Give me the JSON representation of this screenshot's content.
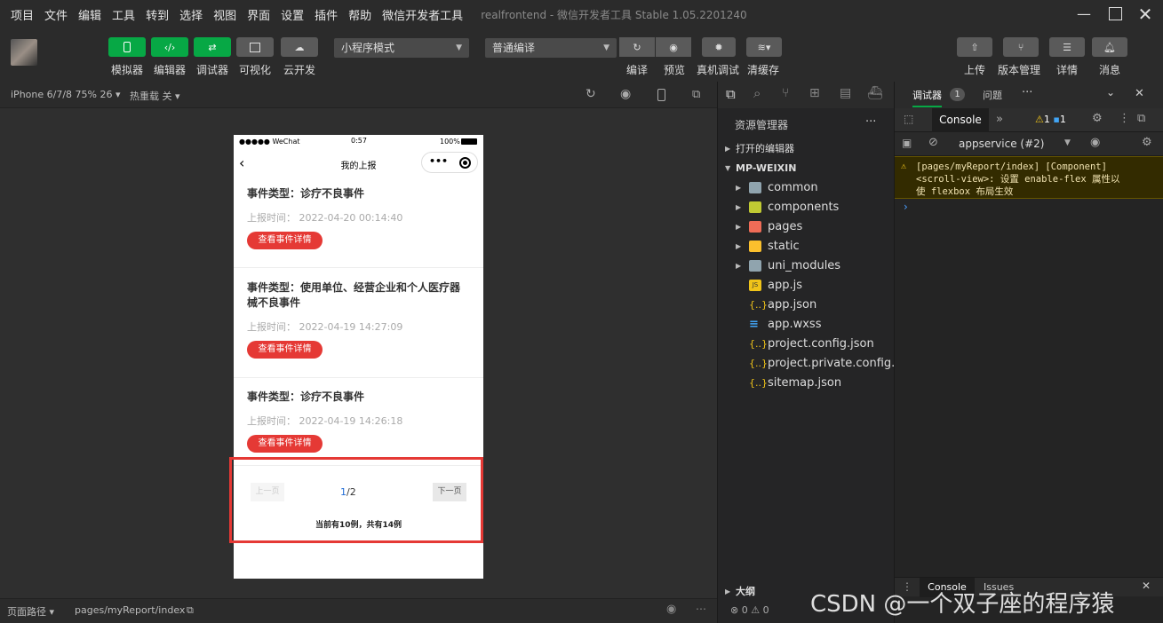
{
  "menubar": {
    "items": [
      "项目",
      "文件",
      "编辑",
      "工具",
      "转到",
      "选择",
      "视图",
      "界面",
      "设置",
      "插件",
      "帮助",
      "微信开发者工具"
    ],
    "window_title": "realfrontend - 微信开发者工具 Stable 1.05.2201240"
  },
  "toolbar": {
    "simulator": "模拟器",
    "editor": "编辑器",
    "debugger": "调试器",
    "visual": "可视化",
    "cloud": "云开发",
    "mode_select": "小程序模式",
    "compile_select": "普通编译",
    "compile": "编译",
    "preview": "预览",
    "real_debug": "真机调试",
    "clear_cache": "清缓存",
    "upload": "上传",
    "version": "版本管理",
    "details": "详情",
    "messages": "消息"
  },
  "simulator": {
    "device": "iPhone 6/7/8 75% 26",
    "hot_reload": "热重载 关"
  },
  "phone": {
    "carrier": "●●●●● WeChat",
    "time": "0:57",
    "battery": "100%",
    "nav_title": "我的上报",
    "cards": [
      {
        "title": "事件类型：诊疗不良事件",
        "time_label": "上报时间：",
        "time": "2022-04-20 00:14:40",
        "button": "查看事件详情"
      },
      {
        "title": "事件类型：使用单位、经营企业和个人医疗器械不良事件",
        "time_label": "上报时间：",
        "time": "2022-04-19 14:27:09",
        "button": "查看事件详情"
      },
      {
        "title": "事件类型：诊疗不良事件",
        "time_label": "上报时间：",
        "time": "2022-04-19 14:26:18",
        "button": "查看事件详情"
      }
    ],
    "pagination": {
      "prev": "上一页",
      "current": "1",
      "total": "/2",
      "next": "下一页",
      "summary": "当前有10例，共有14例"
    }
  },
  "statusbar": {
    "path_label": "页面路径",
    "path": "pages/myReport/index"
  },
  "explorer": {
    "title": "资源管理器",
    "open_editors": "打开的编辑器",
    "project": "MP-WEIXIN",
    "files": [
      "common",
      "components",
      "pages",
      "static",
      "uni_modules",
      "app.js",
      "app.json",
      "app.wxss",
      "project.config.json",
      "project.private.config.js...",
      "sitemap.json"
    ],
    "outline": "大纲",
    "errors": "0",
    "warnings": "0"
  },
  "devtools": {
    "tab_debugger": "调试器",
    "badge": "1",
    "tab_issues": "问题",
    "console_tab": "Console",
    "warn_count": "1",
    "info_count": "1",
    "context": "appservice (#2)",
    "message_line1": "[pages/myReport/index] [Component]",
    "message_line2": "<scroll-view>: 设置 enable-flex 属性以",
    "message_line3": "使 flexbox 布局生效",
    "bottom_console": "Console",
    "bottom_issues": "Issues"
  },
  "watermark": "CSDN @一个双子座的程序猿",
  "colors": {
    "green": "#07a845",
    "red_button": "#e53935",
    "highlight_box": "#e53935"
  }
}
